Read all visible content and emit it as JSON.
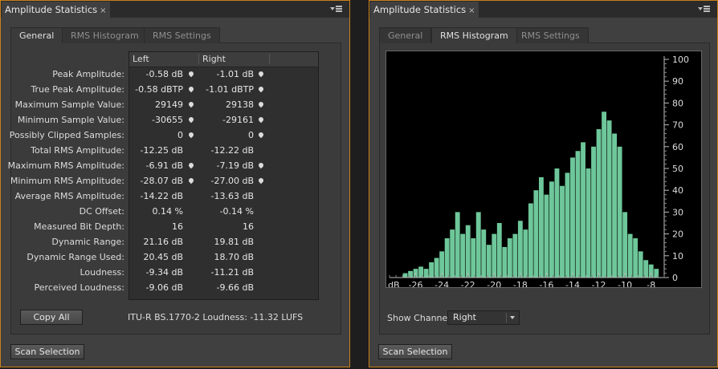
{
  "left_panel": {
    "title": "Amplitude Statistics",
    "close": "×",
    "tabs": [
      "General",
      "RMS Histogram",
      "RMS Settings"
    ],
    "columns": [
      "Left",
      "Right"
    ],
    "rows": [
      {
        "label": "Peak Amplitude:",
        "left": "-0.58 dB",
        "right": "-1.01 dB",
        "pin_left": true,
        "pin_right": true
      },
      {
        "label": "True Peak Amplitude:",
        "left": "-0.58 dBTP",
        "right": "-1.01 dBTP",
        "pin_left": true,
        "pin_right": true
      },
      {
        "label": "Maximum Sample Value:",
        "left": "29149",
        "right": "29138",
        "pin_left": true,
        "pin_right": true
      },
      {
        "label": "Minimum Sample Value:",
        "left": "-30655",
        "right": "-29161",
        "pin_left": true,
        "pin_right": true
      },
      {
        "label": "Possibly Clipped Samples:",
        "left": "0",
        "right": "0",
        "pin_left": true,
        "pin_right": true
      },
      {
        "label": "Total RMS Amplitude:",
        "left": "-12.25 dB",
        "right": "-12.22 dB",
        "pin_left": false,
        "pin_right": false
      },
      {
        "label": "Maximum RMS Amplitude:",
        "left": "-6.91 dB",
        "right": "-7.19 dB",
        "pin_left": true,
        "pin_right": true
      },
      {
        "label": "Minimum RMS Amplitude:",
        "left": "-28.07 dB",
        "right": "-27.00 dB",
        "pin_left": true,
        "pin_right": true
      },
      {
        "label": "Average RMS Amplitude:",
        "left": "-14.22 dB",
        "right": "-13.63 dB",
        "pin_left": false,
        "pin_right": false
      },
      {
        "label": "DC Offset:",
        "left": "0.14 %",
        "right": "-0.14 %",
        "pin_left": false,
        "pin_right": false
      },
      {
        "label": "Measured Bit Depth:",
        "left": "16",
        "right": "16",
        "pin_left": false,
        "pin_right": false
      },
      {
        "label": "Dynamic Range:",
        "left": "21.16 dB",
        "right": "19.81 dB",
        "pin_left": false,
        "pin_right": false
      },
      {
        "label": "Dynamic Range Used:",
        "left": "20.45 dB",
        "right": "18.70 dB",
        "pin_left": false,
        "pin_right": false
      },
      {
        "label": "Loudness:",
        "left": "-9.34 dB",
        "right": "-11.21 dB",
        "pin_left": false,
        "pin_right": false
      },
      {
        "label": "Perceived Loudness:",
        "left": "-9.06 dB",
        "right": "-9.66 dB",
        "pin_left": false,
        "pin_right": false
      }
    ],
    "copy_all": "Copy All",
    "loudness_text": "ITU-R BS.1770-2 Loudness:  -11.32 LUFS",
    "scan_selection": "Scan Selection"
  },
  "right_panel": {
    "title": "Amplitude Statistics",
    "close": "×",
    "tabs": [
      "General",
      "RMS Histogram",
      "RMS Settings"
    ],
    "show_channel_label": "Show Channel:",
    "channel_value": "Right",
    "scan_selection": "Scan Selection"
  },
  "colors": {
    "panel_bg": "#404040",
    "accent_border": "#c7801a",
    "histogram_fill": "#6ec79a",
    "histogram_bg": "#000000"
  },
  "chart_data": {
    "type": "bar",
    "x_label_first": "dB",
    "x_ticks": [
      "-26",
      "-24",
      "-22",
      "-20",
      "-18",
      "-16",
      "-14",
      "-12",
      "-10",
      "-8"
    ],
    "y_ticks": [
      "0",
      "10",
      "20",
      "30",
      "40",
      "50",
      "60",
      "70",
      "80",
      "90",
      "100"
    ],
    "xlim": [
      -28,
      -7
    ],
    "ylim": [
      0,
      100
    ],
    "grid": false,
    "series": [
      {
        "x": [
          -26.8,
          -26.4,
          -26.0,
          -25.6,
          -25.2,
          -24.8,
          -24.4,
          -24.0,
          -23.6,
          -23.2,
          -22.8,
          -22.4,
          -22.0,
          -21.6,
          -21.2,
          -20.8,
          -20.4,
          -20.0,
          -19.6,
          -19.2,
          -18.8,
          -18.4,
          -18.0,
          -17.6,
          -17.2,
          -16.8,
          -16.4,
          -16.0,
          -15.6,
          -15.2,
          -14.8,
          -14.4,
          -14.0,
          -13.6,
          -13.2,
          -12.8,
          -12.4,
          -12.0,
          -11.6,
          -11.2,
          -10.8,
          -10.4,
          -10.0,
          -9.6,
          -9.2,
          -8.8,
          -8.4,
          -8.0,
          -7.6
        ],
        "values": [
          2,
          3,
          4,
          5,
          4,
          7,
          9,
          12,
          18,
          22,
          30,
          20,
          24,
          18,
          30,
          22,
          15,
          20,
          25,
          14,
          18,
          20,
          26,
          22,
          34,
          40,
          46,
          38,
          44,
          50,
          42,
          48,
          55,
          58,
          62,
          50,
          60,
          68,
          76,
          72,
          66,
          60,
          30,
          20,
          18,
          12,
          8,
          6,
          4
        ]
      }
    ]
  }
}
